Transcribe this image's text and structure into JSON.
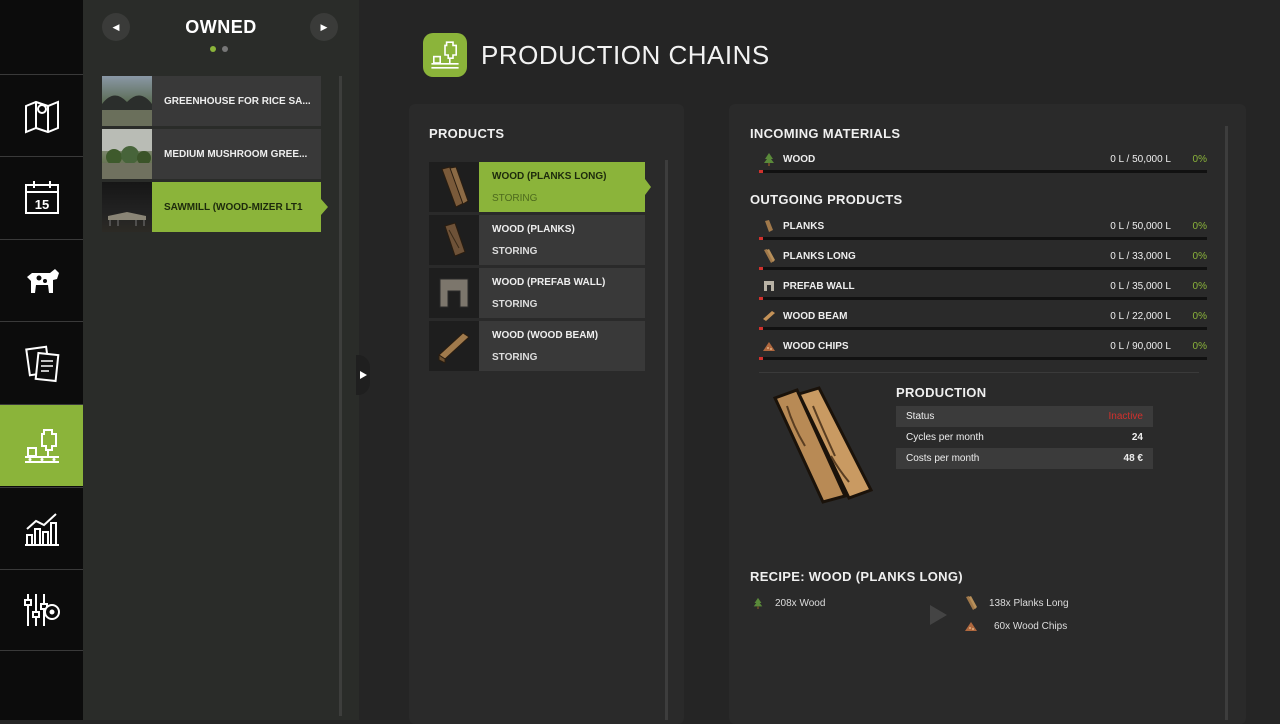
{
  "owned": {
    "title": "OWNED",
    "prev_glyph": "◀",
    "next_glyph": "▶",
    "items": [
      {
        "label": "GREENHOUSE FOR RICE SA..."
      },
      {
        "label": "MEDIUM MUSHROOM GREE..."
      },
      {
        "label": "SAWMILL (WOOD-MIZER LT1"
      }
    ]
  },
  "header": {
    "title": "PRODUCTION CHAINS"
  },
  "products": {
    "title": "PRODUCTS",
    "items": [
      {
        "name": "WOOD (PLANKS LONG)",
        "status": "STORING"
      },
      {
        "name": "WOOD (PLANKS)",
        "status": "STORING"
      },
      {
        "name": "WOOD (PREFAB WALL)",
        "status": "STORING"
      },
      {
        "name": "WOOD (WOOD BEAM)",
        "status": "STORING"
      }
    ]
  },
  "incoming": {
    "title": "INCOMING MATERIALS",
    "items": [
      {
        "name": "WOOD",
        "amount": "0 L / 50,000 L",
        "pct": "0%"
      }
    ]
  },
  "outgoing": {
    "title": "OUTGOING PRODUCTS",
    "items": [
      {
        "name": "PLANKS",
        "amount": "0 L / 50,000 L",
        "pct": "0%"
      },
      {
        "name": "PLANKS LONG",
        "amount": "0 L / 33,000 L",
        "pct": "0%"
      },
      {
        "name": "PREFAB WALL",
        "amount": "0 L / 35,000 L",
        "pct": "0%"
      },
      {
        "name": "WOOD BEAM",
        "amount": "0 L / 22,000 L",
        "pct": "0%"
      },
      {
        "name": "WOOD CHIPS",
        "amount": "0 L / 90,000 L",
        "pct": "0%"
      }
    ]
  },
  "production": {
    "title": "PRODUCTION",
    "status_label": "Status",
    "status_value": "Inactive",
    "cycles_label": "Cycles per month",
    "cycles_value": "24",
    "costs_label": "Costs per month",
    "costs_value": "48 €"
  },
  "recipe": {
    "title": "RECIPE: WOOD (PLANKS LONG)",
    "inputs": [
      "208x Wood"
    ],
    "outputs": [
      "138x Planks Long",
      "60x Wood Chips"
    ]
  },
  "colors": {
    "accent": "#8bb43a",
    "inactive": "#d0312d"
  }
}
